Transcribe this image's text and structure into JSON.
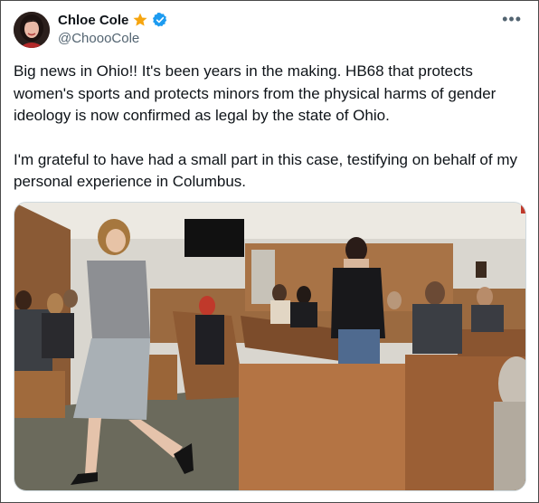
{
  "author": {
    "display_name": "Chloe Cole",
    "handle": "@ChoooCole",
    "avatar_icon": "profile-photo",
    "badges": [
      "star-icon",
      "verified-check-icon"
    ],
    "accent_colors": {
      "star": "#f6a50f",
      "verified": "#1d9bf0"
    }
  },
  "more_label": "•••",
  "tweet": {
    "paragraphs": [
      "Big news in Ohio!! It's been years in the making. HB68 that protects women's sports and protects minors from the physical harms of gender ideology is now confirmed as legal by the state of Ohio.",
      "I'm grateful to have had a small part in this case, testifying on behalf of my personal experience in Columbus."
    ]
  },
  "media": {
    "kind": "photo",
    "icon": "courtroom-photo"
  }
}
